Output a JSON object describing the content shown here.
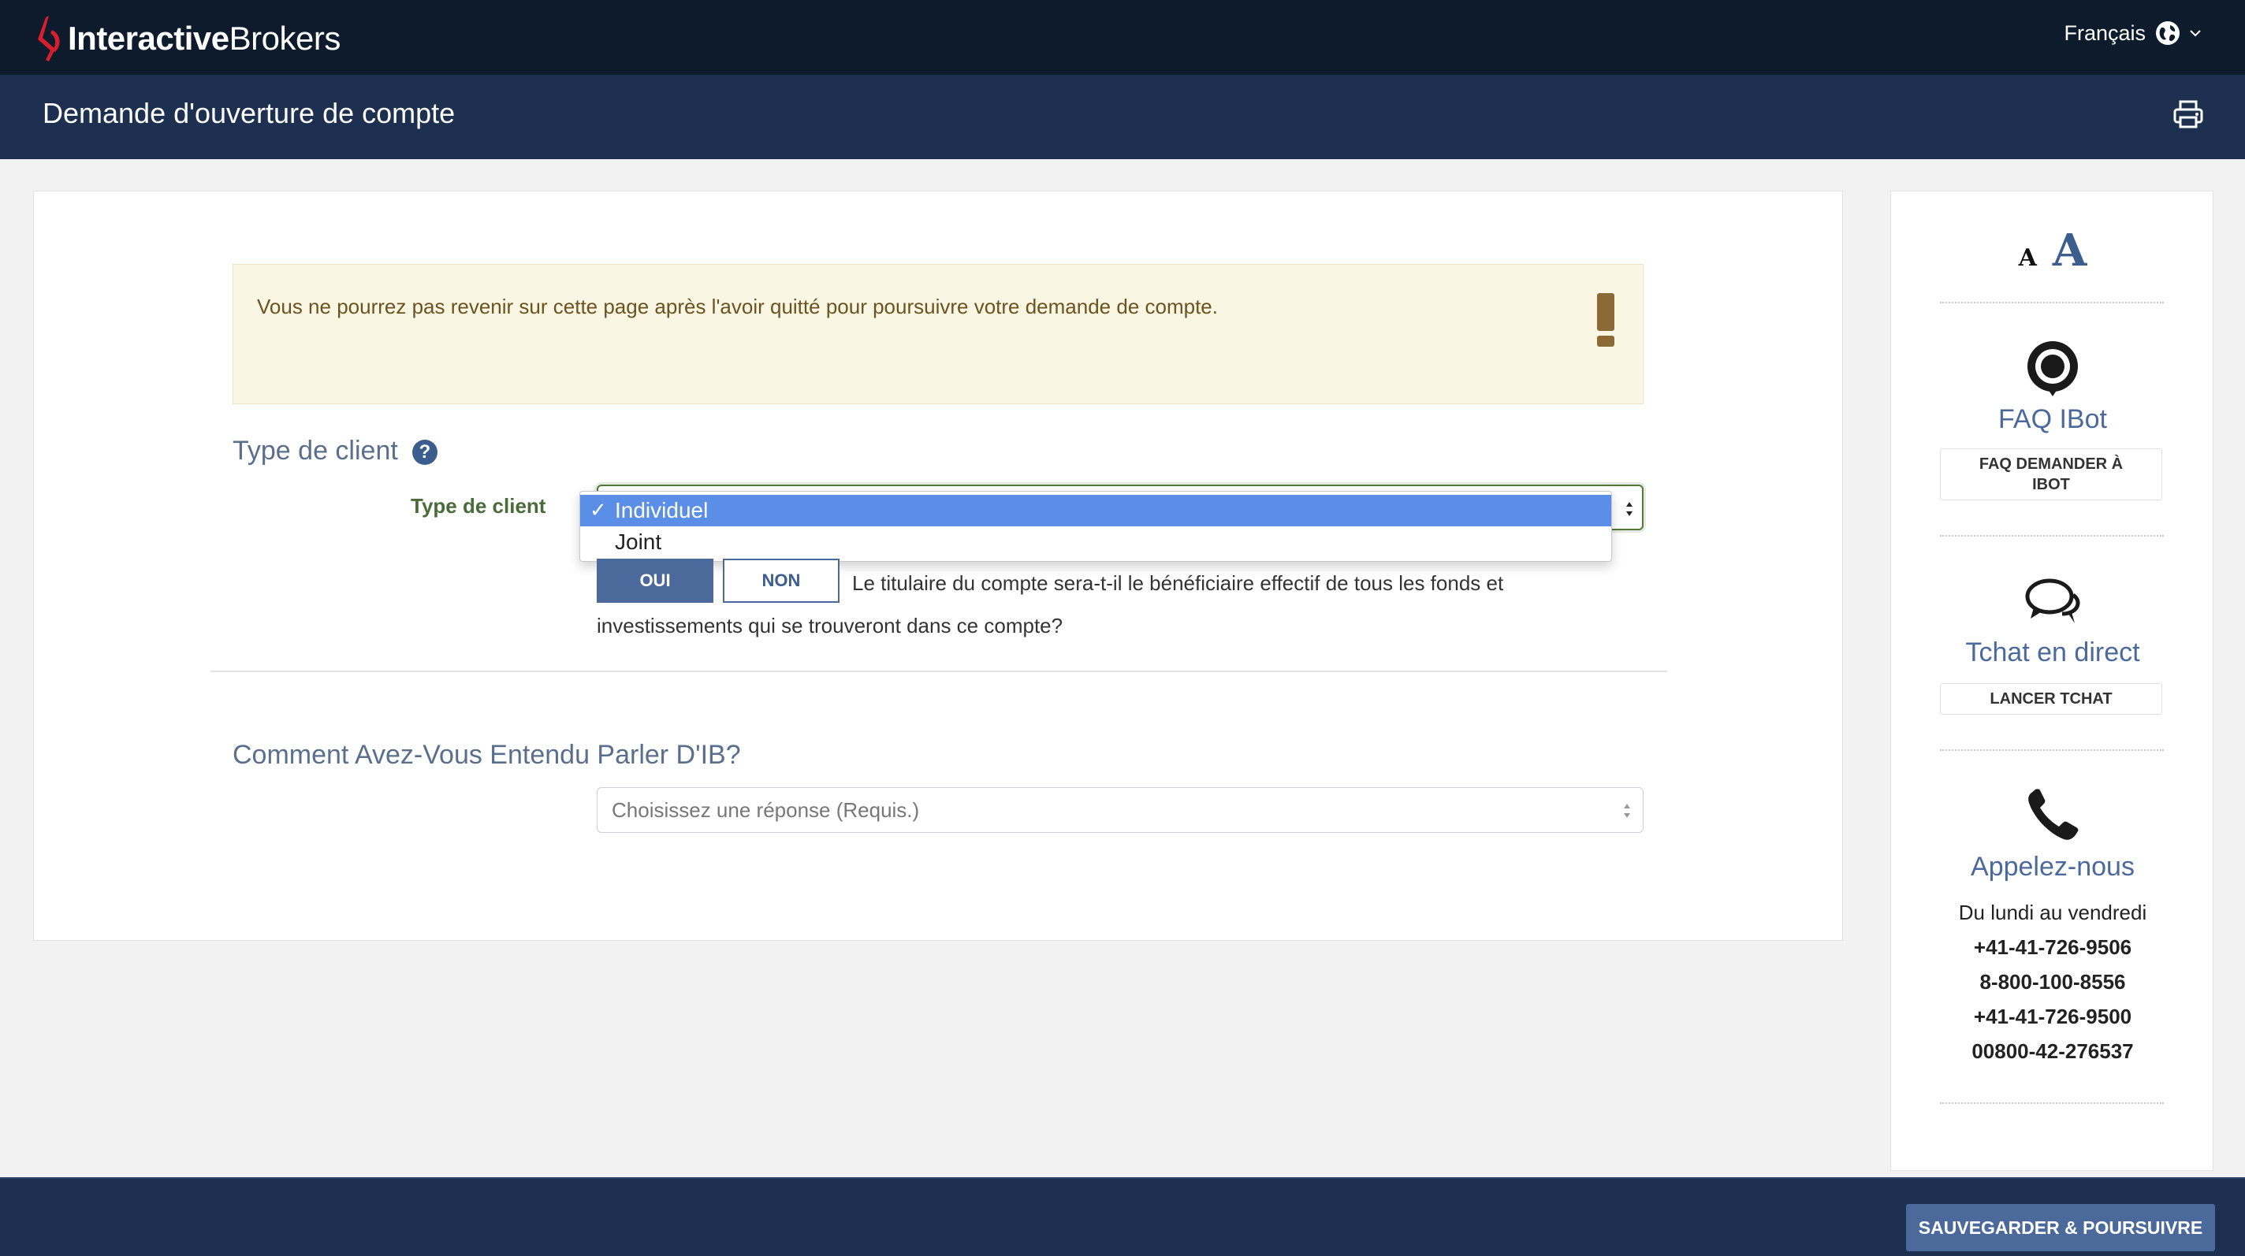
{
  "header": {
    "brand_bold": "Interactive",
    "brand_regular": "Brokers",
    "language": "Français"
  },
  "titlebar": {
    "title": "Demande d'ouverture de compte"
  },
  "alert": {
    "text": "Vous ne pourrez pas revenir sur cette page après l'avoir quitté pour poursuivre votre demande de compte."
  },
  "client_type": {
    "section_title": "Type de client",
    "field_label": "Type de client",
    "options": [
      "Individuel",
      "Joint"
    ],
    "selected": "Individuel",
    "check": "✓"
  },
  "beneficiary": {
    "yes_label": "OUI",
    "no_label": "NON",
    "question": "Le titulaire du compte sera-t-il le bénéficiaire effectif de tous les fonds et investissements qui se trouveront dans ce compte?"
  },
  "referral": {
    "section_title": "Comment Avez-Vous Entendu Parler D'IB?",
    "placeholder": "Choisissez une réponse (Requis.)"
  },
  "sidebar": {
    "font_small": "A",
    "font_large": "A",
    "faq_title": "FAQ IBot",
    "faq_button": "FAQ DEMANDER À IBOT",
    "chat_title": "Tchat en direct",
    "chat_button": "LANCER TCHAT",
    "call_title": "Appelez-nous",
    "call_hours": "Du lundi au vendredi",
    "phones": [
      "+41-41-726-9506",
      "8-800-100-8556",
      "+41-41-726-9500",
      "00800-42-276537"
    ]
  },
  "footer": {
    "save_button": "SAUVEGARDER & POURSUIVRE"
  },
  "colors": {
    "topbar": "#0e1b2c",
    "titlebar": "#1e3050",
    "accent": "#4b6a9b",
    "brand_red": "#d81e2c",
    "selected_option": "#5b8ee6"
  },
  "icons": [
    "ib-logo-icon",
    "globe-icon",
    "chevron-down-icon",
    "printer-icon",
    "exclamation-icon",
    "help-icon",
    "ibot-icon",
    "chat-bubbles-icon",
    "phone-icon"
  ]
}
